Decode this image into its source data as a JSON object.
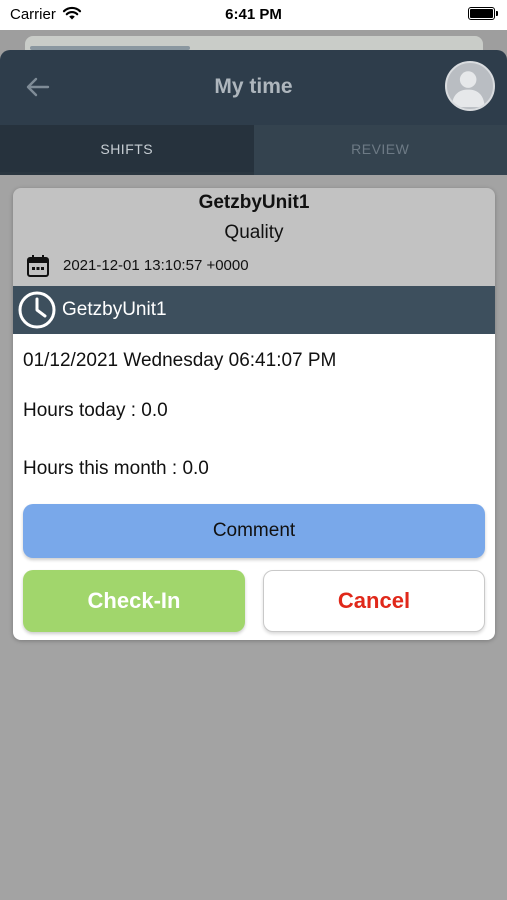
{
  "status_bar": {
    "carrier": "Carrier",
    "time": "6:41 PM",
    "wifi_icon": "wifi-icon",
    "battery_icon": "battery-icon"
  },
  "header": {
    "title": "My time",
    "back_icon": "back-arrow-icon",
    "avatar_icon": "user-avatar-icon"
  },
  "tabs": [
    {
      "label": "SHIFTS",
      "active": true
    },
    {
      "label": "REVIEW",
      "active": false
    }
  ],
  "card": {
    "title": "GetzbyUnit1",
    "subtitle": "Quality",
    "datetime": "2021-12-01 13:10:57 +0000",
    "unit_name": "GetzbyUnit1",
    "date_line": "01/12/2021 Wednesday 06:41:07 PM",
    "hours_today": "Hours today : 0.0",
    "hours_month": "Hours this month : 0.0",
    "comment_label": "Comment",
    "checkin_label": "Check-In",
    "cancel_label": "Cancel"
  },
  "colors": {
    "header_bg": "#2e3d4b",
    "unit_bar_bg": "#3d4f5d",
    "comment_bg": "#79a8ea",
    "checkin_bg": "#a1d66c",
    "cancel_text": "#e0281a"
  }
}
